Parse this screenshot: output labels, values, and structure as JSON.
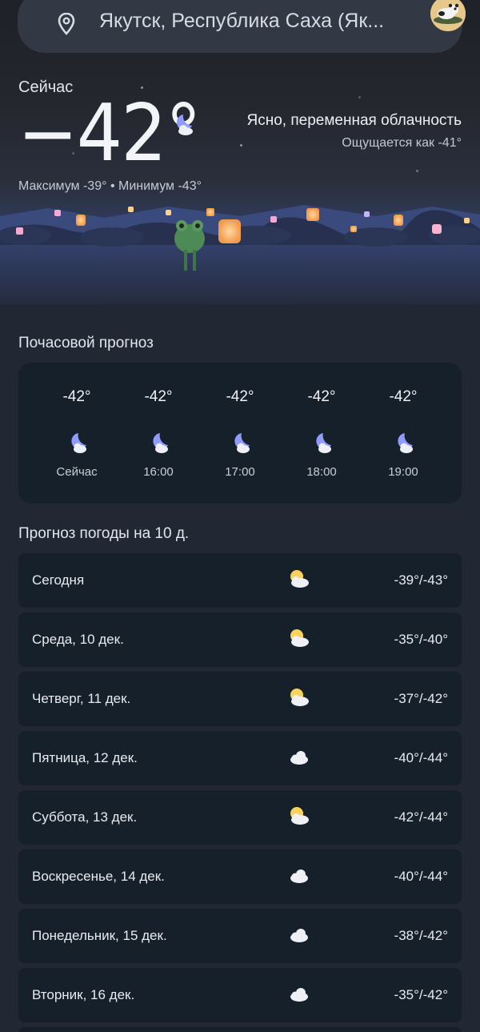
{
  "header": {
    "location": "Якутск, Республика Саха (Як...",
    "icons": {
      "pin": "location-pin-icon",
      "avatar": "profile-avatar"
    }
  },
  "current": {
    "label": "Сейчас",
    "temperature": "−42°",
    "condition": "Ясно, переменная облачность",
    "feels_like": "Ощущается как -41°",
    "min_max": "Максимум -39° • Минимум -43°",
    "icon": "moon-cloud-icon"
  },
  "hourly": {
    "title": "Почасовой прогноз",
    "items": [
      {
        "temp": "-42°",
        "label": "Сейчас",
        "icon": "moon-cloud-icon"
      },
      {
        "temp": "-42°",
        "label": "16:00",
        "icon": "moon-cloud-icon"
      },
      {
        "temp": "-42°",
        "label": "17:00",
        "icon": "moon-cloud-icon"
      },
      {
        "temp": "-42°",
        "label": "18:00",
        "icon": "moon-cloud-icon"
      },
      {
        "temp": "-42°",
        "label": "19:00",
        "icon": "moon-cloud-icon"
      }
    ]
  },
  "daily": {
    "title": "Прогноз погоды на 10 д.",
    "items": [
      {
        "day": "Сегодня",
        "temps": "-39°/-43°",
        "icon": "sun-cloud-icon"
      },
      {
        "day": "Среда, 10 дек.",
        "temps": "-35°/-40°",
        "icon": "sun-cloud-icon"
      },
      {
        "day": "Четверг, 11 дек.",
        "temps": "-37°/-42°",
        "icon": "sun-cloud-icon"
      },
      {
        "day": "Пятница, 12 дек.",
        "temps": "-40°/-44°",
        "icon": "cloud-icon"
      },
      {
        "day": "Суббота, 13 дек.",
        "temps": "-42°/-44°",
        "icon": "sun-cloud-icon"
      },
      {
        "day": "Воскресенье, 14 дек.",
        "temps": "-40°/-44°",
        "icon": "cloud-icon"
      },
      {
        "day": "Понедельник, 15 дек.",
        "temps": "-38°/-42°",
        "icon": "cloud-icon"
      },
      {
        "day": "Вторник, 16 дек.",
        "temps": "-35°/-42°",
        "icon": "cloud-icon"
      }
    ]
  },
  "colors": {
    "background": "#222833",
    "card": "#16202b",
    "moon": "#8f9bff",
    "sun": "#f7d35a"
  }
}
